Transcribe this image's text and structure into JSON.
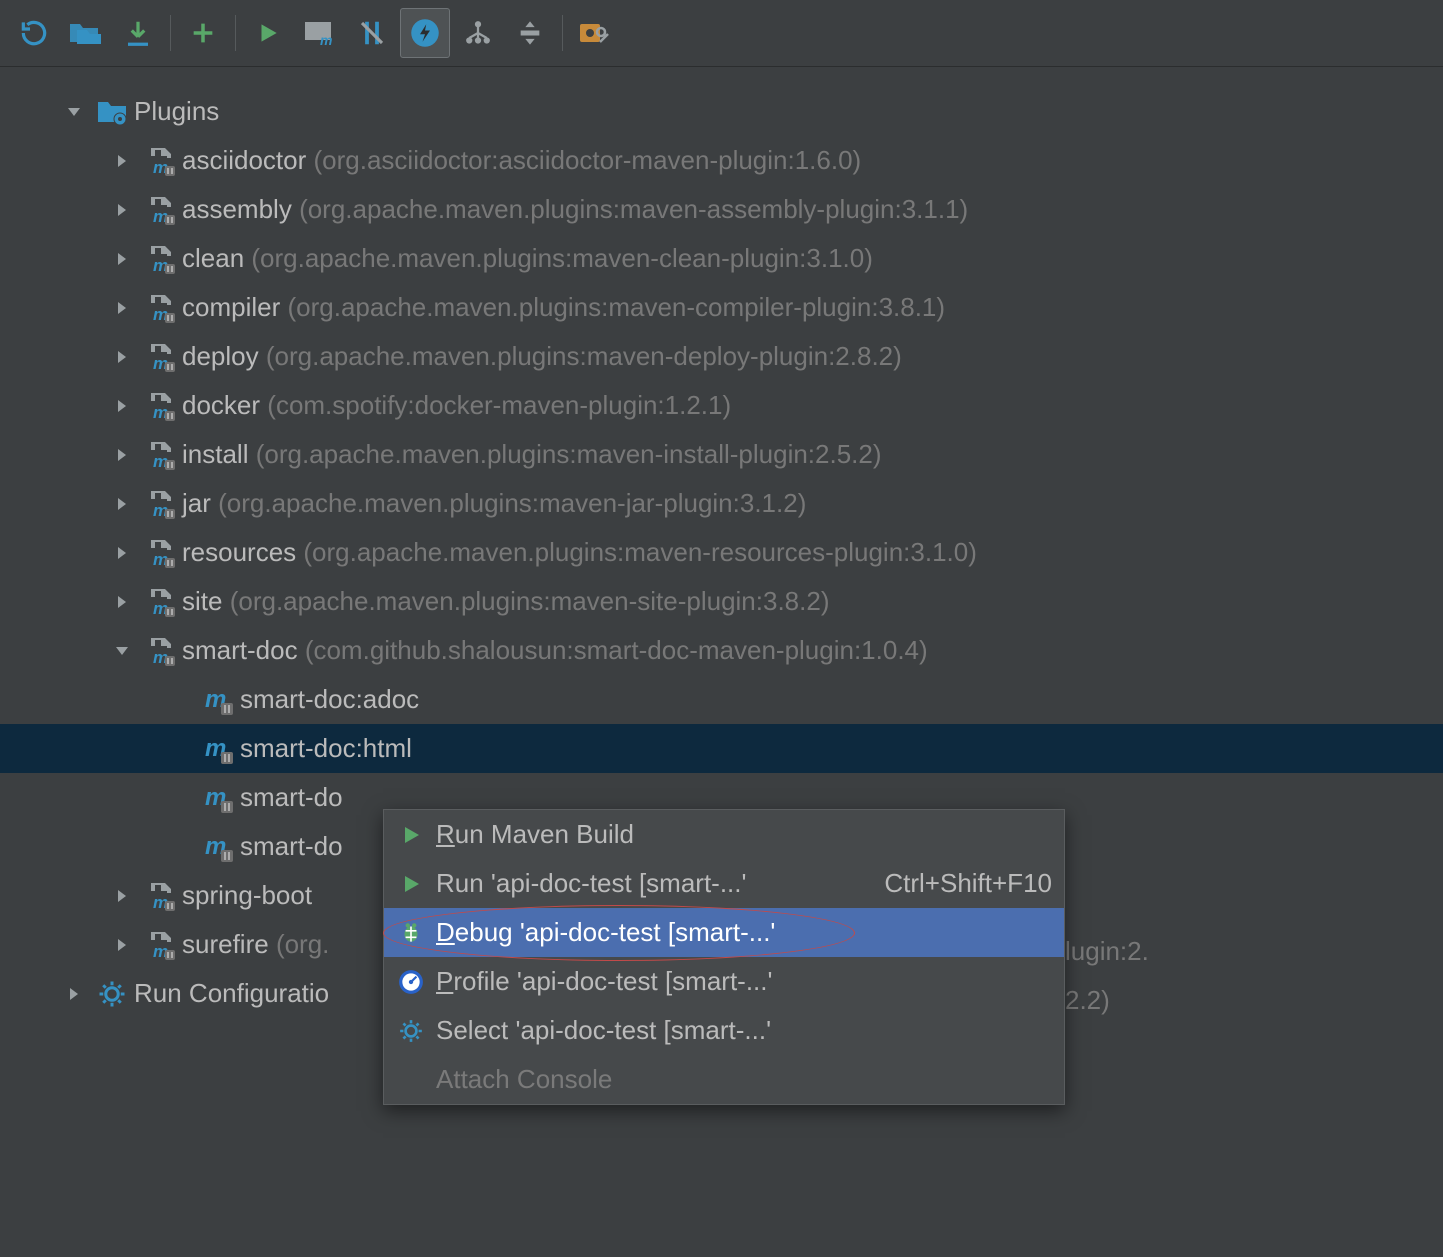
{
  "toolbar": {
    "buttons": [
      "refresh",
      "link",
      "download",
      "add",
      "run",
      "run-m",
      "sync",
      "storm",
      "diagram",
      "collapse",
      "settings"
    ]
  },
  "tree": {
    "plugins_label": "Plugins",
    "items": [
      {
        "name": "asciidoctor",
        "coords": "(org.asciidoctor:asciidoctor-maven-plugin:1.6.0)"
      },
      {
        "name": "assembly",
        "coords": "(org.apache.maven.plugins:maven-assembly-plugin:3.1.1)"
      },
      {
        "name": "clean",
        "coords": "(org.apache.maven.plugins:maven-clean-plugin:3.1.0)"
      },
      {
        "name": "compiler",
        "coords": "(org.apache.maven.plugins:maven-compiler-plugin:3.8.1)"
      },
      {
        "name": "deploy",
        "coords": "(org.apache.maven.plugins:maven-deploy-plugin:2.8.2)"
      },
      {
        "name": "docker",
        "coords": "(com.spotify:docker-maven-plugin:1.2.1)"
      },
      {
        "name": "install",
        "coords": "(org.apache.maven.plugins:maven-install-plugin:2.5.2)"
      },
      {
        "name": "jar",
        "coords": "(org.apache.maven.plugins:maven-jar-plugin:3.1.2)"
      },
      {
        "name": "resources",
        "coords": "(org.apache.maven.plugins:maven-resources-plugin:3.1.0)"
      },
      {
        "name": "site",
        "coords": "(org.apache.maven.plugins:maven-site-plugin:3.8.2)"
      },
      {
        "name": "smart-doc",
        "coords": "(com.github.shalousun:smart-doc-maven-plugin:1.0.4)"
      }
    ],
    "smartdoc_goals": [
      "smart-doc:adoc",
      "smart-doc:html",
      "smart-do",
      "smart-do"
    ],
    "tail_items": [
      {
        "name": "spring-boot",
        "coords": ""
      },
      {
        "name": "surefire",
        "coords": "(org."
      }
    ],
    "tail_right": [
      "lugin:2.",
      "2.2)"
    ],
    "run_config_label": "Run Configuratio"
  },
  "context": {
    "items": [
      {
        "icon": "play",
        "label_pre": "",
        "ul": "R",
        "label_post": "un Maven Build",
        "shortcut": ""
      },
      {
        "icon": "play",
        "label_pre": "Run 'api-doc-test [smart-...'",
        "ul": "",
        "label_post": "",
        "shortcut": "Ctrl+Shift+F10"
      },
      {
        "icon": "bug",
        "label_pre": "",
        "ul": "D",
        "label_post": "ebug 'api-doc-test [smart-...'",
        "shortcut": "",
        "hilite": true
      },
      {
        "icon": "profile",
        "label_pre": "",
        "ul": "P",
        "label_post": "rofile 'api-doc-test [smart-...'",
        "shortcut": ""
      },
      {
        "icon": "gear",
        "label_pre": "Select 'api-doc-test [smart-...'",
        "ul": "",
        "label_post": "",
        "shortcut": ""
      },
      {
        "icon": "",
        "label_pre": "Attach Console",
        "ul": "",
        "label_post": "",
        "shortcut": "",
        "disabled": true
      }
    ]
  },
  "colors": {
    "accent": "#3592c4",
    "green": "#59a869",
    "dim": "#787878"
  }
}
